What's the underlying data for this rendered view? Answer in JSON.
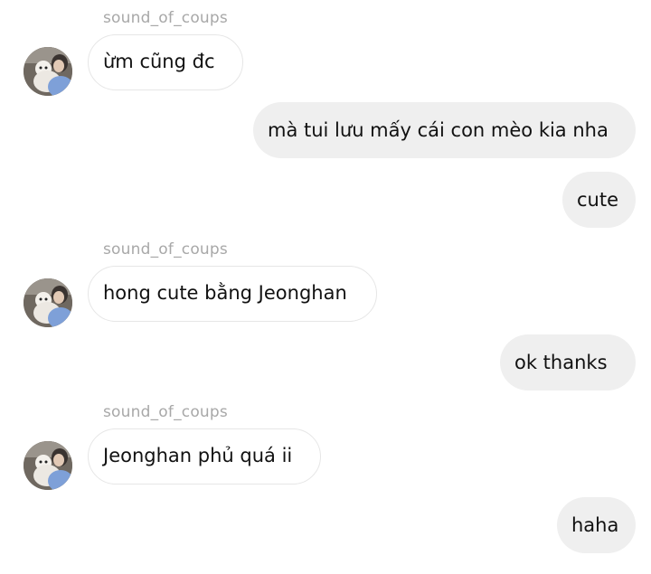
{
  "messages": [
    {
      "type": "incoming",
      "sender": "sound_of_coups",
      "text": "ừm cũng đc",
      "avatar": "user-photo-avatar"
    },
    {
      "type": "outgoing",
      "text": "mà tui lưu mấy cái con mèo kia nha"
    },
    {
      "type": "outgoing",
      "text": "cute"
    },
    {
      "type": "incoming",
      "sender": "sound_of_coups",
      "text": "hong cute bằng Jeonghan",
      "avatar": "user-photo-avatar"
    },
    {
      "type": "outgoing",
      "text": "ok thanks"
    },
    {
      "type": "incoming",
      "sender": "sound_of_coups",
      "text": "Jeonghan phủ quá ii",
      "avatar": "user-photo-avatar"
    },
    {
      "type": "outgoing",
      "text": "haha"
    }
  ],
  "colors": {
    "outgoing_bubble": "#efefef",
    "incoming_border": "#e6e6e6",
    "sender_name": "#a8a8a8",
    "text": "#111111"
  }
}
